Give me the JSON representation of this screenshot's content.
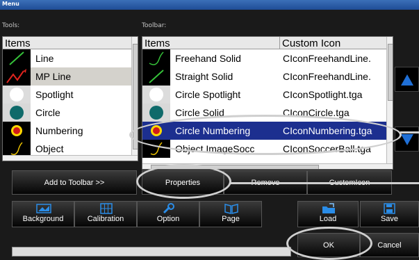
{
  "window": {
    "title": "Menu"
  },
  "tools": {
    "label": "Tools:",
    "header": "Items",
    "items": [
      {
        "label": "Line",
        "icon": "line-icon"
      },
      {
        "label": "MP Line",
        "icon": "mp-line-icon"
      },
      {
        "label": "Spotlight",
        "icon": "spotlight-icon"
      },
      {
        "label": "Circle",
        "icon": "circle-icon"
      },
      {
        "label": "Numbering",
        "icon": "numbering-icon"
      },
      {
        "label": "Object",
        "icon": "object-icon"
      }
    ],
    "selected": "MP Line"
  },
  "toolbar": {
    "label": "Toolbar:",
    "header_items": "Items",
    "header_custom": "Custom Icon",
    "rows": [
      {
        "item": "Freehand Solid",
        "custom": "CIconFreehandLine."
      },
      {
        "item": "Straight Solid",
        "custom": "CIconFreehandLine."
      },
      {
        "item": "Circle Spotlight",
        "custom": "CIconSpotlight.tga"
      },
      {
        "item": "Circle Solid",
        "custom": "CIconCircle.tga"
      },
      {
        "item": "Circle Numbering",
        "custom": "CIconNumbering.tga"
      },
      {
        "item": "Object ImageSocc",
        "custom": "CIconSoccerBall.tga"
      }
    ],
    "selected": "Circle Numbering"
  },
  "buttons": {
    "add_to_toolbar": "Add to Toolbar >>",
    "properties": "Properties",
    "remove": "Remove",
    "custom_icon": "CustomIcon",
    "background": "Background",
    "calibration": "Calibration",
    "option": "Option",
    "page": "Page",
    "load": "Load",
    "save": "Save",
    "ok": "OK",
    "cancel": "Cancel"
  },
  "colors": {
    "selection": "#1c2f8f",
    "accent": "#1f6fd6"
  }
}
